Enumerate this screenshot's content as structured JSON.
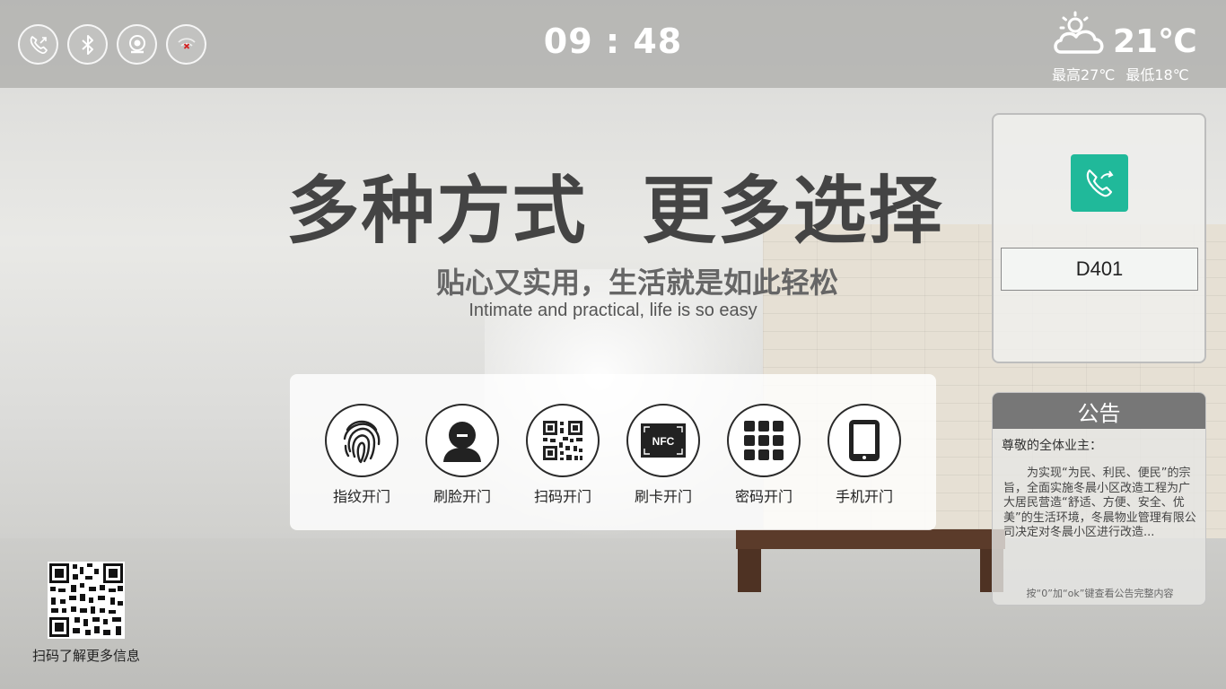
{
  "status_bar": {
    "icons": [
      "intercom-phone-icon",
      "bluetooth-icon",
      "camera-icon",
      "network-disconnected-icon"
    ],
    "clock": "09 : 48",
    "weather": {
      "icon": "partly-cloudy-icon",
      "temperature": "21℃",
      "high": "最高27℃",
      "low": "最低18℃"
    }
  },
  "hero": {
    "headline": "多种方式  更多选择",
    "subline": "贴心又实用，生活就是如此轻松",
    "subline_en": "Intimate and practical, life is so easy"
  },
  "unlock_methods": [
    {
      "icon": "fingerprint-icon",
      "label": "指纹开门"
    },
    {
      "icon": "face-icon",
      "label": "刷脸开门"
    },
    {
      "icon": "qr-code-icon",
      "label": "扫码开门"
    },
    {
      "icon": "nfc-card-icon",
      "label": "刷卡开门"
    },
    {
      "icon": "keypad-icon",
      "label": "密码开门"
    },
    {
      "icon": "mobile-phone-icon",
      "label": "手机开门"
    }
  ],
  "call_panel": {
    "call_icon": "call-icon",
    "room_number": "D401",
    "accent_color": "#20b99a"
  },
  "notice": {
    "title": "公告",
    "greeting": "尊敬的全体业主：",
    "body": "为实现“为民、利民、便民”的宗旨，全面实施冬晨小区改造工程为广大居民营造“舒适、方便、安全、优美”的生活环境，冬晨物业管理有限公司决定对冬晨小区进行改造...",
    "hint": "按“0”加“ok”键查看公告完整内容"
  },
  "qr_info": {
    "caption": "扫码了解更多信息"
  },
  "nfc_text": "NFC"
}
